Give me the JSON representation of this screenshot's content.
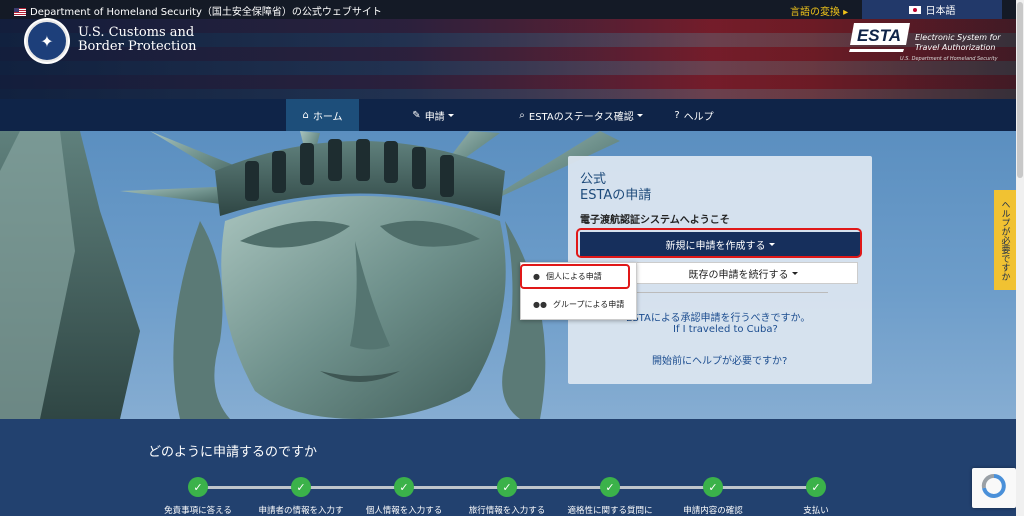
{
  "topbar": {
    "gov_text": "Department of Homeland Security（国土安全保障省）の公式ウェブサイト",
    "lang_change": "言語の変換 ▸",
    "lang_selected": "日本語"
  },
  "header": {
    "agency_line1": "U.S. Customs and",
    "agency_line2": "Border Protection",
    "esta_logo_text": "ESTA",
    "esta_desc_line1": "Electronic System for",
    "esta_desc_line2": "Travel Authorization",
    "esta_dept": "U.S. Department of Homeland Security"
  },
  "nav": {
    "items": [
      {
        "label": "ホーム",
        "icon": "home-icon",
        "active": true
      },
      {
        "label": "申請",
        "icon": "pencil-icon",
        "dropdown": true
      },
      {
        "label": "ESTAのステータス確認",
        "icon": "search-icon",
        "dropdown": true
      },
      {
        "label": "ヘルプ",
        "icon": "question-circle-icon"
      }
    ]
  },
  "card": {
    "kicker": "公式",
    "title": "ESTAの申請",
    "welcome": "電子渡航認証システムへようこそ",
    "new_app_button": "新規に申請を作成する",
    "continue_button": "既存の申請を続行する",
    "cuba_question": "ESTAによる承認申請を行うべきですか。",
    "cuba_question_prefix": "・",
    "cuba_english": "If I traveled to Cuba?",
    "help_link": "開始前にヘルプが必要ですか?"
  },
  "dropdown": {
    "items": [
      {
        "label": "個人による申請",
        "icon": "user-icon"
      },
      {
        "label": "グループによる申請",
        "icon": "users-icon"
      }
    ]
  },
  "side_help": "ヘルプが必要ですか",
  "how": {
    "title": "どのように申請するのですか",
    "steps": [
      "免責事項に答える",
      "申請者の情報を入力す",
      "個人情報を入力する",
      "旅行情報を入力する",
      "適格性に関する質問に",
      "申請内容の確認",
      "支払い"
    ]
  },
  "colors": {
    "nav_bg": "#0f2448",
    "primary_button": "#162f5c",
    "highlight_outline": "#e01818",
    "step_complete": "#3bb24a",
    "side_tab": "#f1c232"
  }
}
